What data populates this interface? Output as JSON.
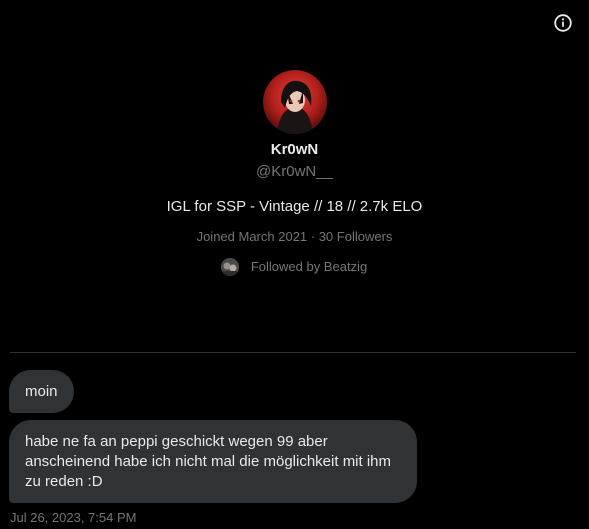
{
  "header": {
    "info_icon": "info-circle-icon"
  },
  "profile": {
    "avatar_icon": "profile-avatar-image",
    "display_name": "Kr0wN",
    "handle": "@Kr0wN__",
    "bio": "IGL for SSP - Vintage // 18 // 2.7k ELO",
    "joined_followers": "Joined March 2021 · 30 Followers",
    "followed_by": "Followed by Beatzig",
    "follower_avatar_icon": "follower-avatar-image"
  },
  "messages": [
    {
      "text": "moin"
    },
    {
      "text": "habe ne fa an peppi geschickt wegen 99 aber anscheinend habe ich nicht mal die möglichkeit mit ihm zu reden :D"
    }
  ],
  "timestamp": "Jul 26, 2023, 7:54 PM",
  "colors": {
    "background": "#000000",
    "bubble": "#2f3336",
    "primary_text": "#e7e9ea",
    "secondary_text": "#71767b",
    "divider": "#2f3336"
  }
}
